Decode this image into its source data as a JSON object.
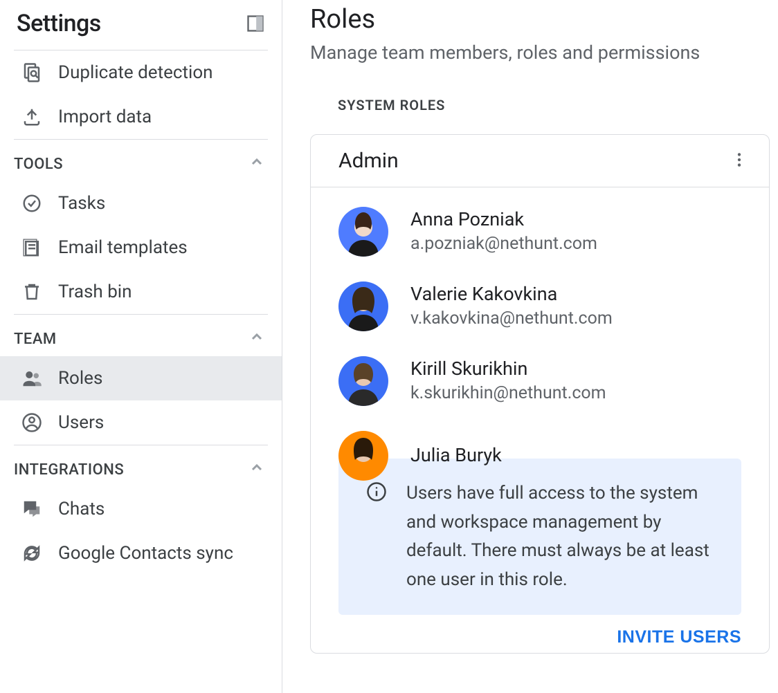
{
  "sidebar": {
    "title": "Settings",
    "items_top": [
      {
        "label": "Duplicate detection",
        "icon": "duplicate-icon"
      },
      {
        "label": "Import data",
        "icon": "import-icon"
      }
    ],
    "tools_label": "TOOLS",
    "tools_items": [
      {
        "label": "Tasks",
        "icon": "tasks-icon"
      },
      {
        "label": "Email templates",
        "icon": "templates-icon"
      },
      {
        "label": "Trash bin",
        "icon": "trash-icon"
      }
    ],
    "team_label": "TEAM",
    "team_items": [
      {
        "label": "Roles",
        "icon": "roles-icon",
        "active": true
      },
      {
        "label": "Users",
        "icon": "users-icon"
      }
    ],
    "integrations_label": "INTEGRATIONS",
    "integrations_items": [
      {
        "label": "Chats",
        "icon": "chats-icon"
      },
      {
        "label": "Google Contacts sync",
        "icon": "sync-icon"
      }
    ]
  },
  "main": {
    "title": "Roles",
    "subtitle": "Manage team members, roles and permissions",
    "system_roles_label": "SYSTEM ROLES",
    "role": {
      "name": "Admin",
      "users": [
        {
          "name": "Anna Pozniak",
          "email": "a.pozniak@nethunt.com",
          "avatar_bg": "#4f7cff"
        },
        {
          "name": "Valerie Kakovkina",
          "email": "v.kakovkina@nethunt.com",
          "avatar_bg": "#3b6ef5"
        },
        {
          "name": "Kirill Skurikhin",
          "email": "k.skurikhin@nethunt.com",
          "avatar_bg": "#3b6ef5"
        },
        {
          "name": "Julia Buryk",
          "email": "",
          "avatar_bg": "#ff8a00"
        }
      ],
      "info_text": "Users have full access to the system and workspace management by default. There must always be at least one user in this role.",
      "invite_label": "INVITE USERS"
    }
  }
}
